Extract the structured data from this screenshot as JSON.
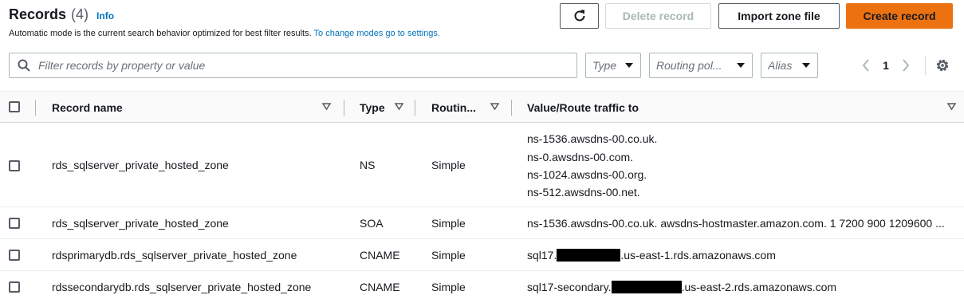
{
  "header": {
    "title": "Records",
    "count": "(4)",
    "info_label": "Info",
    "description": "Automatic mode is the current search behavior optimized for best filter results.",
    "description_link": "To change modes go to settings."
  },
  "toolbar": {
    "delete_label": "Delete record",
    "import_label": "Import zone file",
    "create_label": "Create record"
  },
  "filters": {
    "search_placeholder": "Filter records by property or value",
    "type_label": "Type",
    "routing_label": "Routing pol...",
    "alias_label": "Alias"
  },
  "pagination": {
    "current_page": "1"
  },
  "table": {
    "columns": [
      "Record name",
      "Type",
      "Routin...",
      "Value/Route traffic to"
    ],
    "rows": [
      {
        "name": "rds_sqlserver_private_hosted_zone",
        "type": "NS",
        "routing": "Simple",
        "values": [
          "ns-1536.awsdns-00.co.uk.",
          "ns-0.awsdns-00.com.",
          "ns-1024.awsdns-00.org.",
          "ns-512.awsdns-00.net."
        ]
      },
      {
        "name": "rds_sqlserver_private_hosted_zone",
        "type": "SOA",
        "routing": "Simple",
        "value": "ns-1536.awsdns-00.co.uk. awsdns-hostmaster.amazon.com. 1 7200 900 1209600 ..."
      },
      {
        "name": "rdsprimarydb.rds_sqlserver_private_hosted_zone",
        "type": "CNAME",
        "routing": "Simple",
        "value_prefix": "sql17.",
        "value_suffix": ".us-east-1.rds.amazonaws.com"
      },
      {
        "name": "rdssecondarydb.rds_sqlserver_private_hosted_zone",
        "type": "CNAME",
        "routing": "Simple",
        "value_prefix": "sql17-secondary.",
        "value_suffix": ".us-east-2.rds.amazonaws.com"
      }
    ]
  },
  "colors": {
    "accent": "#ec7211",
    "link": "#0073bb"
  },
  "icons": [
    "refresh-icon",
    "search-icon",
    "caret-down-icon",
    "chevron-left-icon",
    "chevron-right-icon",
    "gear-icon",
    "sort-icon"
  ]
}
